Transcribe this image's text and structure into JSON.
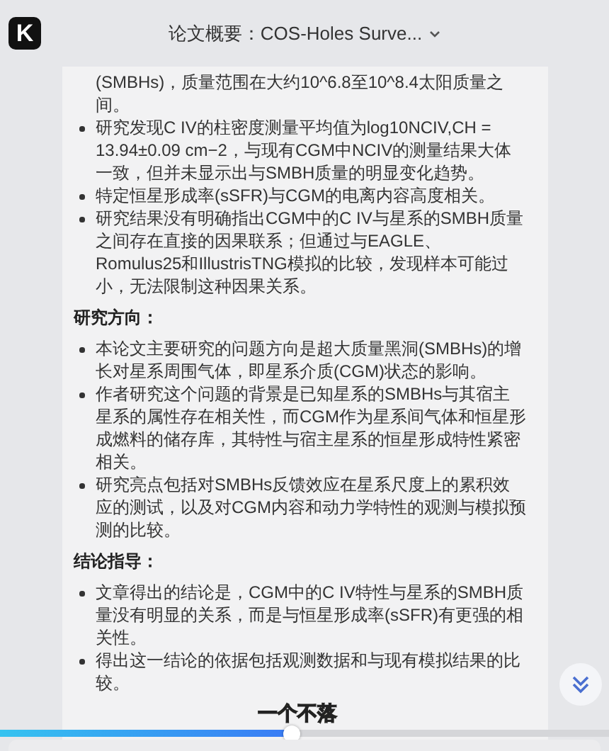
{
  "app": {
    "logo": "K",
    "title": "论文概要：COS-Holes Surve..."
  },
  "sections": [
    {
      "items": [
        {
          "kind": "continuation",
          "text": "(SMBHs)，质量范围在大约10^6.8至10^8.4太阳质量之间。"
        },
        {
          "kind": "bullet",
          "text": "研究发现C IV的柱密度测量平均值为log10NCIV,CH = 13.94±0.09 cm−2，与现有CGM中NCIV的测量结果大体一致，但并未显示出与SMBH质量的明显变化趋势。"
        },
        {
          "kind": "bullet",
          "text": "特定恒星形成率(sSFR)与CGM的电离内容高度相关。"
        },
        {
          "kind": "bullet",
          "text": "研究结果没有明确指出CGM中的C IV与星系的SMBH质量之间存在直接的因果联系；但通过与EAGLE、Romulus25和IllustrisTNG模拟的比较，发现样本可能过小，无法限制这种因果关系。"
        }
      ]
    },
    {
      "heading": "研究方向：",
      "items": [
        {
          "kind": "bullet",
          "text": "本论文主要研究的问题方向是超大质量黑洞(SMBHs)的增长对星系周围气体，即星系介质(CGM)状态的影响。"
        },
        {
          "kind": "bullet",
          "text": "作者研究这个问题的背景是已知星系的SMBHs与其宿主星系的属性存在相关性，而CGM作为星系间气体和恒星形成燃料的储存库，其特性与宿主星系的恒星形成特性紧密相关。"
        },
        {
          "kind": "bullet",
          "text": "研究亮点包括对SMBHs反馈效应在星系尺度上的累积效应的测试，以及对CGM内容和动力学特性的观测与模拟预测的比较。"
        }
      ]
    },
    {
      "heading": "结论指导：",
      "items": [
        {
          "kind": "bullet",
          "text": "文章得出的结论是，CGM中的C IV特性与星系的SMBH质量没有明显的关系，而是与恒星形成率(sSFR)有更强的相关性。"
        },
        {
          "kind": "bullet",
          "text": "得出这一结论的依据包括观测数据和与现有模拟结果的比较。"
        }
      ]
    }
  ],
  "video": {
    "caption": "一个不落",
    "progress": {
      "level": 0.48
    }
  }
}
